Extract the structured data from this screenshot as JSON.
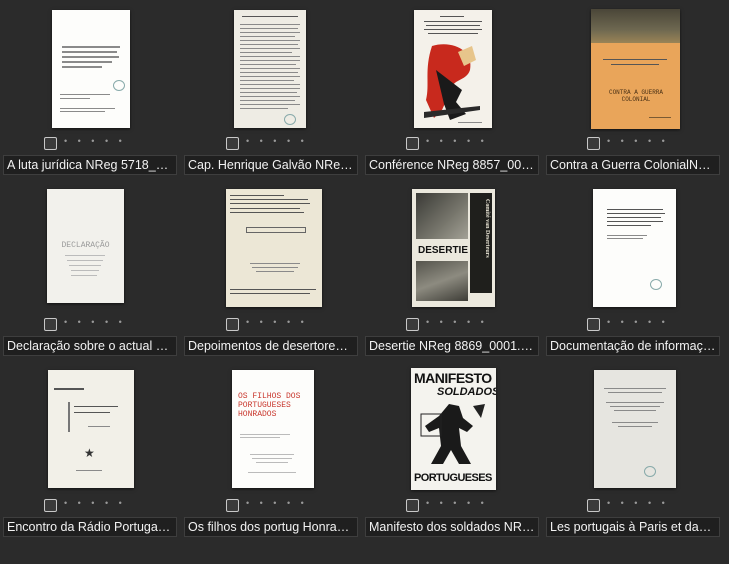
{
  "items": [
    {
      "caption": "A luta jurídica NReg 5718_000..."
    },
    {
      "caption": "Cap. Henrique Galvão NReg64..."
    },
    {
      "caption": "Conférence NReg 8857_0001.jpg"
    },
    {
      "caption": "Contra a Guerra ColonialNReg ..."
    },
    {
      "caption": "Declaração sobre o actual MP..."
    },
    {
      "caption": "Depoimentos de desertores d..."
    },
    {
      "caption": "Desertie NReg 8869_0001.jpg"
    },
    {
      "caption": "Documentação de informação..."
    },
    {
      "caption": "Encontro da Rádio Portugal Li..."
    },
    {
      "caption": "Os filhos dos portug Honrado..."
    },
    {
      "caption": "Manifesto dos soldados NReg ..."
    },
    {
      "caption": "Les portugais à Paris et dans l..."
    }
  ],
  "rating_glyphs": "• • • • •",
  "thumb_text": {
    "t3": "CONTRA A GUERRA COLONIAL",
    "t4": "DECLARAÇÃO",
    "t6": "DESERTIE",
    "t6side": "Comité van Deserteurs",
    "t9": "OS FILHOS DOS PORTUGUESES HONRADOS",
    "t10a": "MANIFESTO",
    "t10b": "SOLDADOS",
    "t10c": "PORTUGUESES"
  },
  "colors": {
    "background": "#2b2b2b",
    "caption_bg": "#1f1f1f",
    "caption_text": "#f2f2f2"
  }
}
